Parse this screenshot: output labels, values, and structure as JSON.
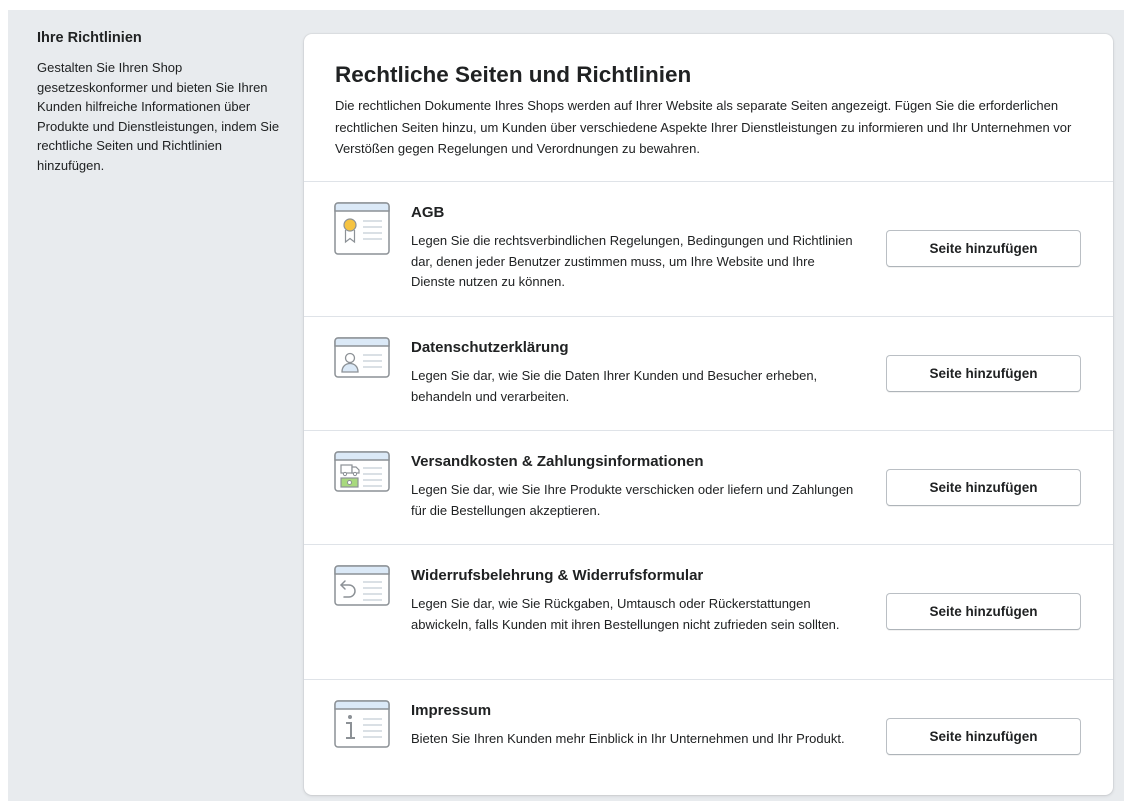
{
  "aside": {
    "title": "Ihre Richtlinien",
    "description": "Gestalten Sie Ihren Shop gesetzeskonformer und bieten Sie Ihren Kunden hilfreiche Informationen über Produkte und Dienstleistungen, indem Sie rechtliche Seiten und Richtlinien hinzufügen."
  },
  "card": {
    "title": "Rechtliche Seiten und Richtlinien",
    "description": "Die rechtlichen Dokumente Ihres Shops werden auf Ihrer Website als separate Seiten angezeigt. Fügen Sie die erforderlichen rechtlichen Seiten hinzu, um Kunden über verschiedene Aspekte Ihrer Dienstleistungen zu informieren und Ihr Unternehmen vor Verstößen gegen Regelungen und Verordnungen zu bewahren."
  },
  "policies": [
    {
      "title": "AGB",
      "description": "Legen Sie die rechtsverbindlichen Regelungen, Bedingungen und Richtlinien dar, denen jeder Benutzer zustimmen muss, um Ihre Website und Ihre Dienste nutzen zu können.",
      "button": "Seite hinzufügen",
      "icon": "award-document-icon"
    },
    {
      "title": "Datenschutzerklärung",
      "description": "Legen Sie dar, wie Sie die Daten Ihrer Kunden und Besucher erheben, behandeln und verarbeiten.",
      "button": "Seite hinzufügen",
      "icon": "person-document-icon"
    },
    {
      "title": "Versandkosten & Zahlungsinformationen",
      "description": "Legen Sie dar, wie Sie Ihre Produkte verschicken oder liefern und Zahlungen für die Bestellungen akzeptieren.",
      "button": "Seite hinzufügen",
      "icon": "shipping-payment-document-icon"
    },
    {
      "title": "Widerrufsbelehrung & Widerrufsformular",
      "description": "Legen Sie dar, wie Sie Rückgaben, Umtausch oder Rückerstattungen abwickeln, falls Kunden mit ihren Bestellungen nicht zufrieden sein sollten.",
      "button": "Seite hinzufügen",
      "icon": "return-document-icon"
    },
    {
      "title": "Impressum",
      "description": "Bieten Sie Ihren Kunden mehr Einblick in Ihr Unternehmen und Ihr Produkt.",
      "button": "Seite hinzufügen",
      "icon": "info-document-icon"
    }
  ],
  "colors": {
    "page_background": "#e8ebee",
    "card_background": "#ffffff",
    "divider": "#dfe3e8",
    "icon_header_blue": "#dbe9f7",
    "icon_stroke": "#8c9196",
    "award_gold": "#f5c342",
    "money_green": "#a8d97e"
  }
}
